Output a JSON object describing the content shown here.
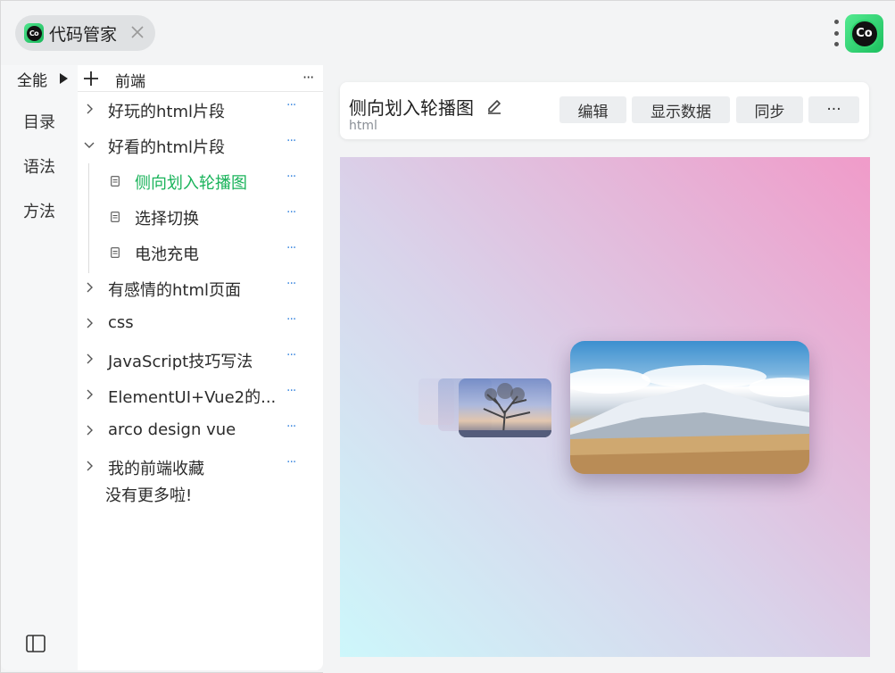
{
  "app": {
    "title": "代码管家",
    "logo_text": "Co"
  },
  "rail": {
    "header_label": "全能",
    "items": [
      "目录",
      "语法",
      "方法"
    ]
  },
  "tree": {
    "header_title": "前端",
    "more_label": "···",
    "nodes": [
      {
        "label": "好玩的html片段",
        "expanded": false
      },
      {
        "label": "好看的html片段",
        "expanded": true,
        "children": [
          {
            "label": "侧向划入轮播图",
            "active": true
          },
          {
            "label": "选择切换"
          },
          {
            "label": "电池充电"
          }
        ]
      },
      {
        "label": "有感情的html页面",
        "expanded": false
      },
      {
        "label": "css",
        "expanded": false
      },
      {
        "label": "JavaScript技巧写法",
        "expanded": false
      },
      {
        "label": "ElementUI+Vue2的...",
        "expanded": false
      },
      {
        "label": "arco design vue",
        "expanded": false
      },
      {
        "label": "我的前端收藏",
        "expanded": false
      }
    ],
    "end_text": "没有更多啦!"
  },
  "card": {
    "title": "侧向划入轮播图",
    "subtitle": "html",
    "buttons": {
      "edit": "编辑",
      "show_data": "显示数据",
      "sync": "同步",
      "more": "···"
    }
  },
  "colors": {
    "accent": "#19b35a",
    "dots": "#4a90e2"
  }
}
